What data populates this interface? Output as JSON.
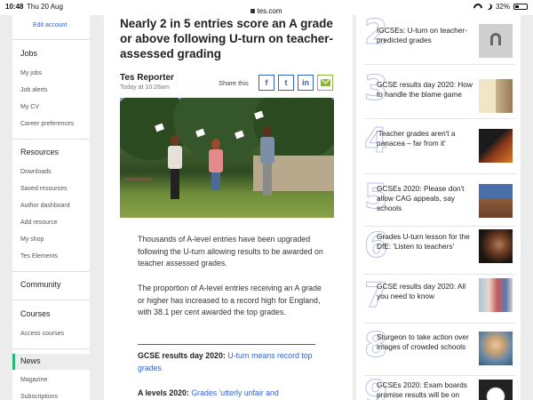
{
  "status_bar": {
    "time": "10:48",
    "date": "Thu 20 Aug",
    "url": "tes.com",
    "battery": "32%",
    "battery_level": 0.32
  },
  "sidebar": {
    "edit_account": "Edit account",
    "sections": [
      {
        "heading": "Jobs",
        "items": [
          "My jobs",
          "Job alerts",
          "My CV",
          "Career preferences"
        ]
      },
      {
        "heading": "Resources",
        "items": [
          "Downloads",
          "Saved resources",
          "Author dashboard",
          "Add resource",
          "My shop",
          "Tes Elements"
        ]
      },
      {
        "heading": "Community",
        "items": []
      },
      {
        "heading": "Courses",
        "items": [
          "Access courses"
        ]
      },
      {
        "heading": "News",
        "items": [
          "Magazine",
          "Subscriptions"
        ]
      }
    ],
    "active_section": "News"
  },
  "article": {
    "headline": "Nearly 2 in 5 entries score an A grade or above following U-turn on teacher-assessed grading",
    "author": "Tes Reporter",
    "published": "Today at 10:28am",
    "share_label": "Share this",
    "share_buttons": [
      {
        "name": "facebook",
        "glyph": "f"
      },
      {
        "name": "twitter",
        "glyph": "t"
      },
      {
        "name": "linkedin",
        "glyph": "in"
      },
      {
        "name": "email",
        "glyph": ""
      }
    ],
    "paragraphs": [
      "Thousands of A-level entries have been upgraded following the U-turn allowing results to be awarded on teacher assessed grades.",
      "The proportion of A-level entries receiving an A grade or higher has increased to a record high for England, with 38.1 per cent awarded the top grades."
    ],
    "related": [
      {
        "lead": "GCSE results day 2020:",
        "link": "U-turn means record top grades"
      },
      {
        "lead": "A levels 2020:",
        "link": "Grades 'utterly unfair and"
      }
    ]
  },
  "most_read": [
    {
      "rank": "2",
      "title": "IGCSEs: U-turn on teacher-predicted grades"
    },
    {
      "rank": "3",
      "title": "GCSE results day 2020: How to handle the blame game"
    },
    {
      "rank": "4",
      "title": "'Teacher grades aren't a panacea – far from it'"
    },
    {
      "rank": "5",
      "title": "GCSEs 2020: Please don't allow CAG appeals, say schools"
    },
    {
      "rank": "6",
      "title": "Grades U-turn lesson for the DfE: 'Listen to teachers'"
    },
    {
      "rank": "7",
      "title": "GCSE results day 2020: All you need to know"
    },
    {
      "rank": "8",
      "title": "Sturgeon to take action over images of crowded schools"
    },
    {
      "rank": "9",
      "title": "GCSEs 2020: Exam boards promise results will be on"
    }
  ],
  "colors": {
    "link": "#3563c9",
    "active_marker": "#2bb673",
    "email_green": "#8bb63a",
    "rank_outline": "#b9c3e6"
  }
}
